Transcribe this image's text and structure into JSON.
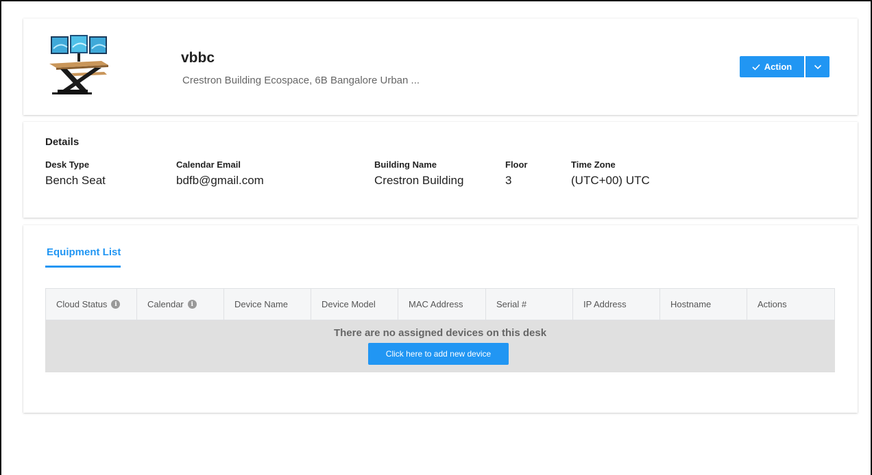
{
  "header": {
    "desk_name": "vbbc",
    "address": "Crestron Building Ecospace, 6B Bangalore Urban ...",
    "image_icon": "standing-desk-monitors-image",
    "action_label": "Action"
  },
  "details": {
    "title": "Details",
    "fields": [
      {
        "label": "Desk Type",
        "value": "Bench Seat"
      },
      {
        "label": "Calendar Email",
        "value": "bdfb@gmail.com"
      },
      {
        "label": "Building Name",
        "value": "Crestron Building"
      },
      {
        "label": "Floor",
        "value": "3"
      },
      {
        "label": "Time Zone",
        "value": "(UTC+00) UTC"
      }
    ]
  },
  "equipment": {
    "tab_label": "Equipment List",
    "columns": [
      "Cloud Status",
      "Calendar",
      "Device Name",
      "Device Model",
      "MAC Address",
      "Serial #",
      "IP Address",
      "Hostname",
      "Actions"
    ],
    "empty_message": "There are no assigned devices on this desk",
    "add_button_label": "Click here to add new device"
  },
  "colors": {
    "accent": "#2196f3",
    "table_header_bg": "#f5f6f7",
    "empty_row_bg": "#e0e0e0"
  }
}
